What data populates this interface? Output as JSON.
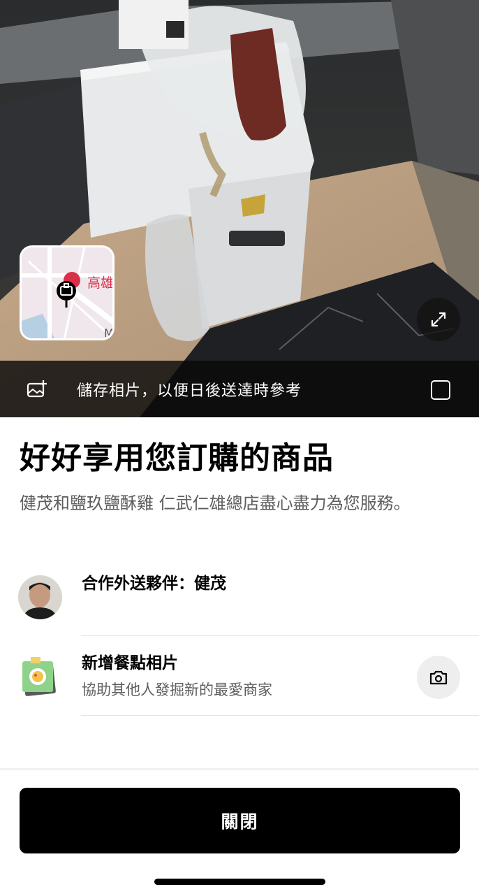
{
  "photo": {
    "map_thumbnail": {
      "place_label": "高雄",
      "edge_label": "M"
    },
    "expand_icon": "expand-arrows-icon",
    "save_bar": {
      "text": "儲存相片，以便日後送達時參考",
      "icon": "add-image-icon"
    }
  },
  "content": {
    "title": "好好享用您訂購的商品",
    "subtitle": "健茂和鹽玖鹽酥雞 仁武仁雄總店盡心盡力為您服務。",
    "courier": {
      "label": "合作外送夥伴：健茂"
    },
    "add_photo": {
      "title": "新增餐點相片",
      "subtitle": "協助其他人發掘新的最愛商家",
      "icon": "camera-icon"
    }
  },
  "footer": {
    "close_label": "關閉"
  },
  "colors": {
    "accent": "#000000",
    "map_pin": "#d9304a",
    "secondary_text": "#5e5e5e"
  }
}
